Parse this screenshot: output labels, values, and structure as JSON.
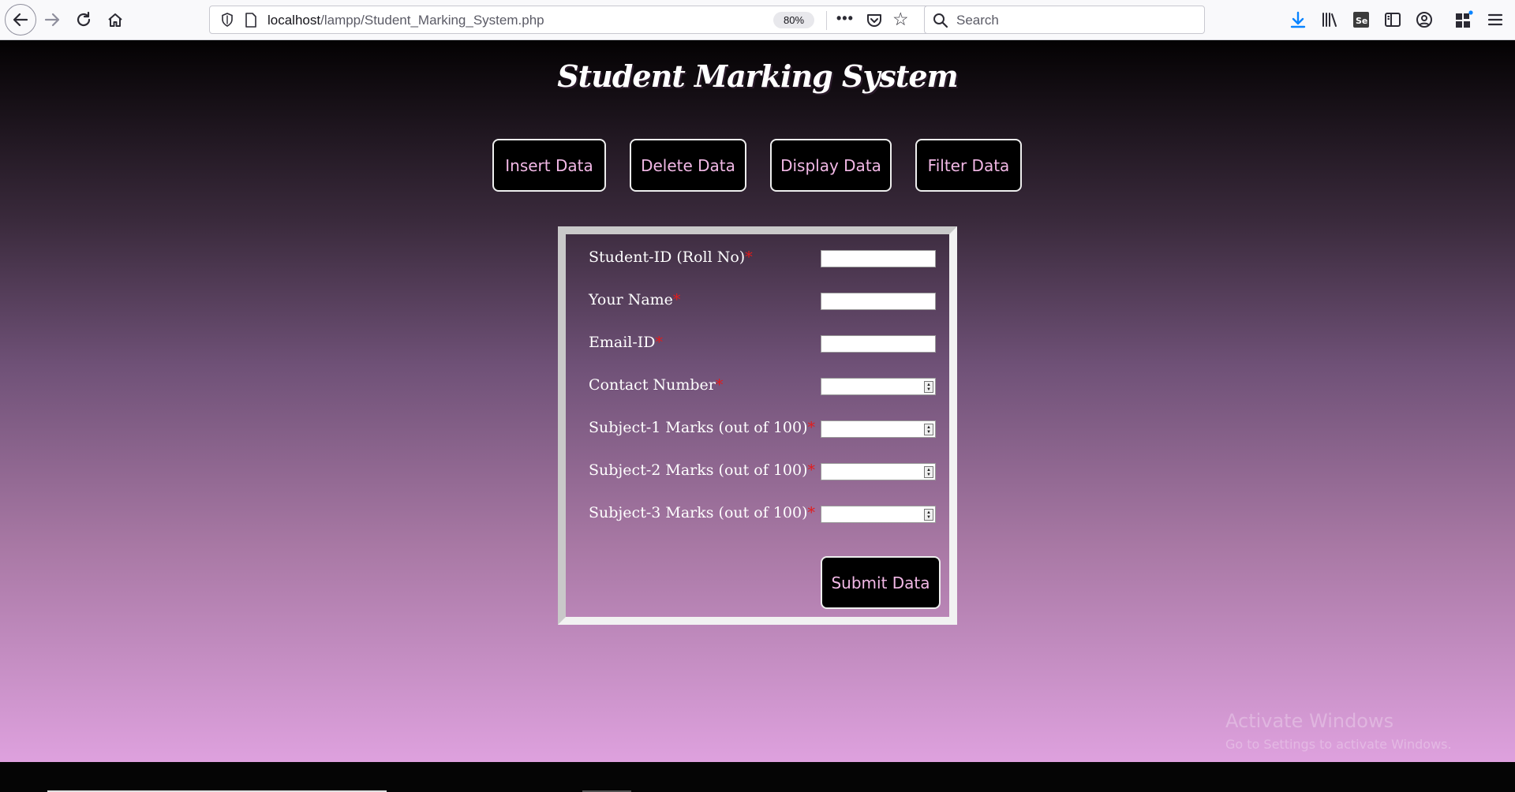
{
  "browser": {
    "url_host": "localhost",
    "url_path": "/lampp/Student_Marking_System.php",
    "zoom": "80%",
    "search_placeholder": "Search"
  },
  "page": {
    "title": "Student Marking System",
    "nav": [
      "Insert Data",
      "Delete Data",
      "Display Data",
      "Filter Data"
    ],
    "fields": [
      {
        "label": "Student-ID (Roll No)",
        "type": "text"
      },
      {
        "label": "Your Name",
        "type": "text"
      },
      {
        "label": "Email-ID",
        "type": "text"
      },
      {
        "label": "Contact Number",
        "type": "number"
      },
      {
        "label": "Subject-1 Marks (out of 100)",
        "type": "number"
      },
      {
        "label": "Subject-2 Marks (out of 100)",
        "type": "number"
      },
      {
        "label": "Subject-3 Marks (out of 100)",
        "type": "number"
      }
    ],
    "required_marker": "*",
    "submit_label": "Submit Data"
  },
  "watermark": {
    "line1": "Activate Windows",
    "line2": "Go to Settings to activate Windows."
  }
}
